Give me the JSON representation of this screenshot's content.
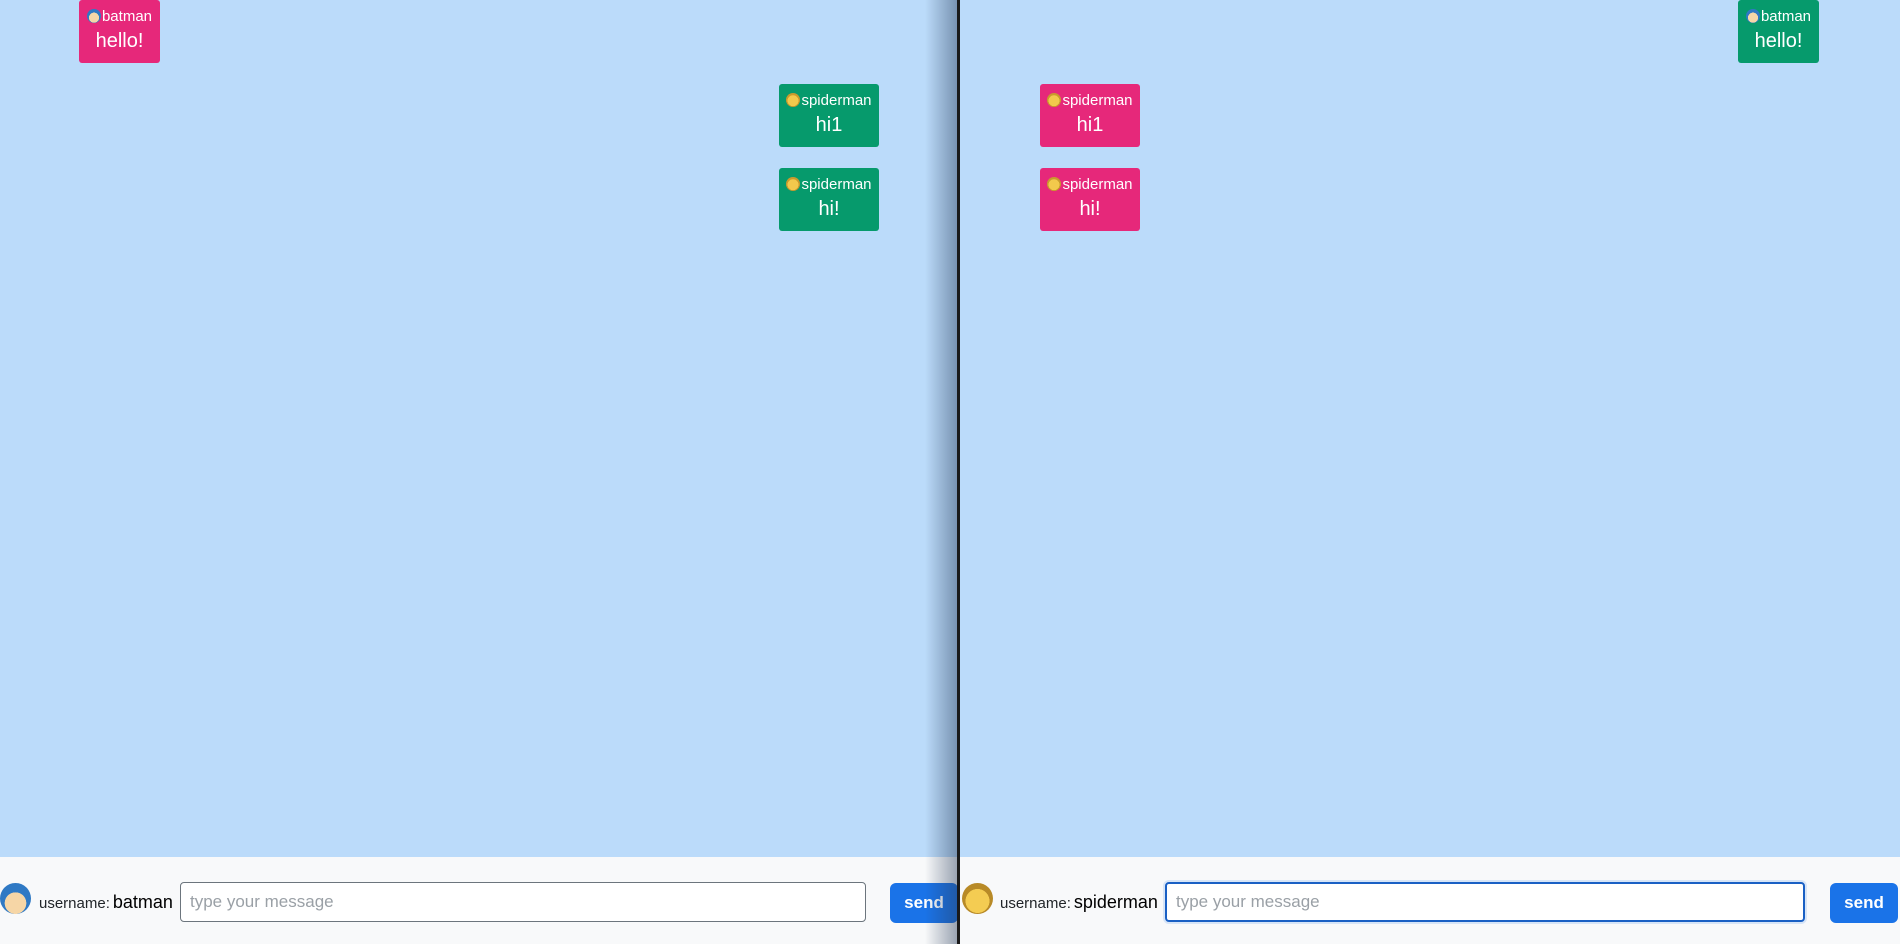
{
  "colors": {
    "chat_background": "#bbdbfa",
    "own_message": "#e6287a",
    "other_message": "#069a6c",
    "send_button": "#1a73e8",
    "footer_background": "#f8f9fa"
  },
  "left_window": {
    "messages": [
      {
        "user": "batman",
        "avatar": "batman-avatar-icon",
        "text": "hello!",
        "color": "#e6287a",
        "side": "left"
      },
      {
        "user": "spiderman",
        "avatar": "spiderman-avatar-icon",
        "text": "hi1",
        "color": "#069a6c",
        "side": "right"
      },
      {
        "user": "spiderman",
        "avatar": "spiderman-avatar-icon",
        "text": "hi!",
        "color": "#069a6c",
        "side": "right"
      }
    ],
    "footer": {
      "avatar": "batman-avatar-icon",
      "username_label": "username:",
      "username": "batman",
      "input_placeholder": "type your message",
      "send_label": "send"
    }
  },
  "right_window": {
    "messages": [
      {
        "user": "batman",
        "avatar": "batman-avatar-icon",
        "text": "hello!",
        "color": "#069a6c",
        "side": "right"
      },
      {
        "user": "spiderman",
        "avatar": "spiderman-avatar-icon",
        "text": "hi1",
        "color": "#e6287a",
        "side": "left"
      },
      {
        "user": "spiderman",
        "avatar": "spiderman-avatar-icon",
        "text": "hi!",
        "color": "#e6287a",
        "side": "left"
      }
    ],
    "footer": {
      "avatar": "spiderman-avatar-icon",
      "username_label": "username:",
      "username": "spiderman",
      "input_placeholder": "type your message",
      "send_label": "send"
    }
  }
}
